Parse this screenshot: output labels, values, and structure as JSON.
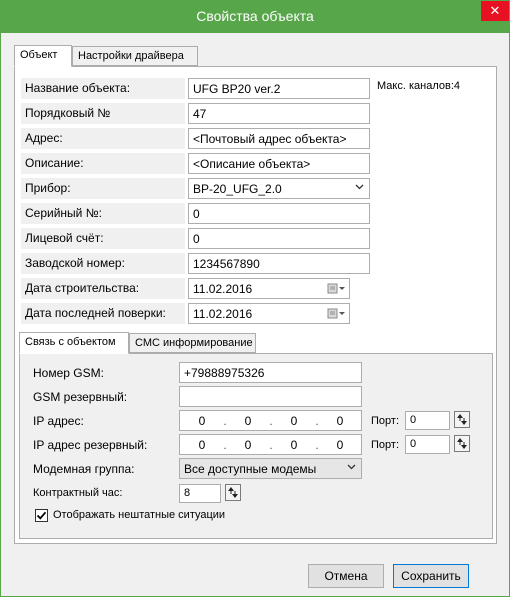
{
  "window": {
    "title": "Свойства объекта",
    "close_glyph": "✕"
  },
  "tabs": [
    {
      "label": "Объект",
      "active": true
    },
    {
      "label": "Настройки драйвера",
      "active": false
    }
  ],
  "object": {
    "name_label": "Название объекта:",
    "name_value": "UFG BP20 ver.2",
    "max_channels": "Макс. каналов:4",
    "order_label": "Порядковый №",
    "order_value": "47",
    "address_label": "Адрес:",
    "address_value": "<Почтовый адрес объекта>",
    "description_label": "Описание:",
    "description_value": "<Описание объекта>",
    "device_label": "Прибор:",
    "device_value": "BP-20_UFG_2.0",
    "serial_label": "Серийный №:",
    "serial_value": "0",
    "account_label": "Лицевой счёт:",
    "account_value": "0",
    "factory_label": "Заводской номер:",
    "factory_value": "1234567890",
    "build_date_label": "Дата строительства:",
    "build_date_value": "11.02.2016",
    "check_date_label": "Дата последней поверки:",
    "check_date_value": "11.02.2016"
  },
  "subtabs": [
    {
      "label": "Связь с объектом",
      "active": true
    },
    {
      "label": "СМС информирование",
      "active": false
    }
  ],
  "connection": {
    "gsm_label": "Номер GSM:",
    "gsm_value": "+79888975326",
    "gsm_backup_label": "GSM резервный:",
    "gsm_backup_value": "",
    "ip_label": "IP адрес:",
    "ip_octets": [
      "0",
      "0",
      "0",
      "0"
    ],
    "ip_backup_label": "IP адрес резервный:",
    "ip_backup_octets": [
      "0",
      "0",
      "0",
      "0"
    ],
    "ip_separator": ".",
    "port_label": "Порт:",
    "port_value": "0",
    "port_backup_label": "Порт:",
    "port_backup_value": "0",
    "modem_group_label": "Модемная группа:",
    "modem_group_value": "Все доступные модемы",
    "contract_hour_label": "Контрактный час:",
    "contract_hour_value": "8",
    "show_emergency_label": "Отображать нештатные ситуации",
    "show_emergency_checked": true
  },
  "buttons": {
    "cancel": "Отмена",
    "save": "Сохранить"
  },
  "colors": {
    "titlebar": "#57a64a",
    "close": "#e81123"
  },
  "icons": {
    "dropdown": "chevron-down-icon",
    "calendar": "calendar-icon",
    "spinner": "spinner-icon",
    "checkmark": "✔"
  }
}
